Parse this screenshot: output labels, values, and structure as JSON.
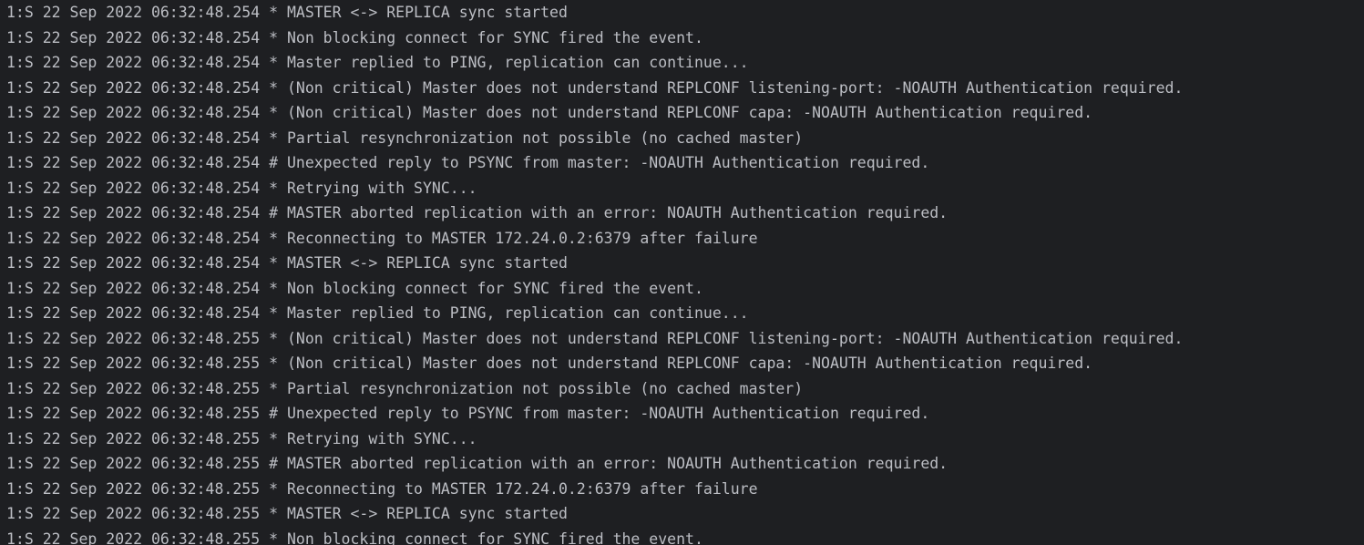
{
  "console": {
    "lines": [
      "1:S 22 Sep 2022 06:32:48.254 * MASTER <-> REPLICA sync started",
      "1:S 22 Sep 2022 06:32:48.254 * Non blocking connect for SYNC fired the event.",
      "1:S 22 Sep 2022 06:32:48.254 * Master replied to PING, replication can continue...",
      "1:S 22 Sep 2022 06:32:48.254 * (Non critical) Master does not understand REPLCONF listening-port: -NOAUTH Authentication required.",
      "1:S 22 Sep 2022 06:32:48.254 * (Non critical) Master does not understand REPLCONF capa: -NOAUTH Authentication required.",
      "1:S 22 Sep 2022 06:32:48.254 * Partial resynchronization not possible (no cached master)",
      "1:S 22 Sep 2022 06:32:48.254 # Unexpected reply to PSYNC from master: -NOAUTH Authentication required.",
      "1:S 22 Sep 2022 06:32:48.254 * Retrying with SYNC...",
      "1:S 22 Sep 2022 06:32:48.254 # MASTER aborted replication with an error: NOAUTH Authentication required.",
      "1:S 22 Sep 2022 06:32:48.254 * Reconnecting to MASTER 172.24.0.2:6379 after failure",
      "1:S 22 Sep 2022 06:32:48.254 * MASTER <-> REPLICA sync started",
      "1:S 22 Sep 2022 06:32:48.254 * Non blocking connect for SYNC fired the event.",
      "1:S 22 Sep 2022 06:32:48.254 * Master replied to PING, replication can continue...",
      "1:S 22 Sep 2022 06:32:48.255 * (Non critical) Master does not understand REPLCONF listening-port: -NOAUTH Authentication required.",
      "1:S 22 Sep 2022 06:32:48.255 * (Non critical) Master does not understand REPLCONF capa: -NOAUTH Authentication required.",
      "1:S 22 Sep 2022 06:32:48.255 * Partial resynchronization not possible (no cached master)",
      "1:S 22 Sep 2022 06:32:48.255 # Unexpected reply to PSYNC from master: -NOAUTH Authentication required.",
      "1:S 22 Sep 2022 06:32:48.255 * Retrying with SYNC...",
      "1:S 22 Sep 2022 06:32:48.255 # MASTER aborted replication with an error: NOAUTH Authentication required.",
      "1:S 22 Sep 2022 06:32:48.255 * Reconnecting to MASTER 172.24.0.2:6379 after failure",
      "1:S 22 Sep 2022 06:32:48.255 * MASTER <-> REPLICA sync started",
      "1:S 22 Sep 2022 06:32:48.255 * Non blocking connect for SYNC fired the event."
    ]
  },
  "colors": {
    "background": "#1e1f22",
    "text": "#bcbec4"
  }
}
